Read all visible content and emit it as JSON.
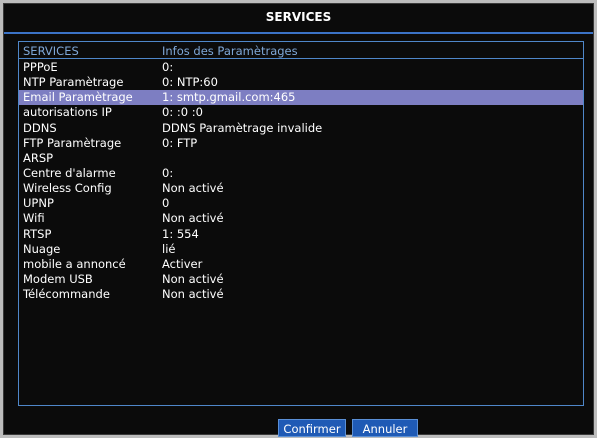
{
  "window": {
    "title": "SERVICES"
  },
  "table": {
    "headers": {
      "name": "SERVICES",
      "value": "Infos des Paramètrages"
    },
    "rows": [
      {
        "name": "PPPoE",
        "value": "0:"
      },
      {
        "name": "NTP Paramètrage",
        "value": "0: NTP:60"
      },
      {
        "name": "Email Paramètrage",
        "value": "1: smtp.gmail.com:465"
      },
      {
        "name": "autorisations IP",
        "value": "0: :0 :0"
      },
      {
        "name": "DDNS",
        "value": "DDNS Paramètrage invalide"
      },
      {
        "name": "FTP Paramètrage",
        "value": "0: FTP"
      },
      {
        "name": "ARSP",
        "value": ""
      },
      {
        "name": "Centre d'alarme",
        "value": "0:"
      },
      {
        "name": "Wireless Config",
        "value": "Non activé"
      },
      {
        "name": "UPNP",
        "value": "0"
      },
      {
        "name": "Wifi",
        "value": "Non activé"
      },
      {
        "name": "RTSP",
        "value": "1: 554"
      },
      {
        "name": "Nuage",
        "value": "lié"
      },
      {
        "name": "mobile a annoncé",
        "value": "Activer"
      },
      {
        "name": "Modem USB",
        "value": "Non activé"
      },
      {
        "name": "Télécommande",
        "value": "Non activé"
      }
    ],
    "selected_row": "Email Paramètrage"
  },
  "buttons": {
    "confirm": "Confirmer",
    "cancel": "Annuler"
  },
  "colors": {
    "accent": "#3b73c7",
    "selected": "#7d7ec2",
    "button": "#1f5ab5"
  }
}
